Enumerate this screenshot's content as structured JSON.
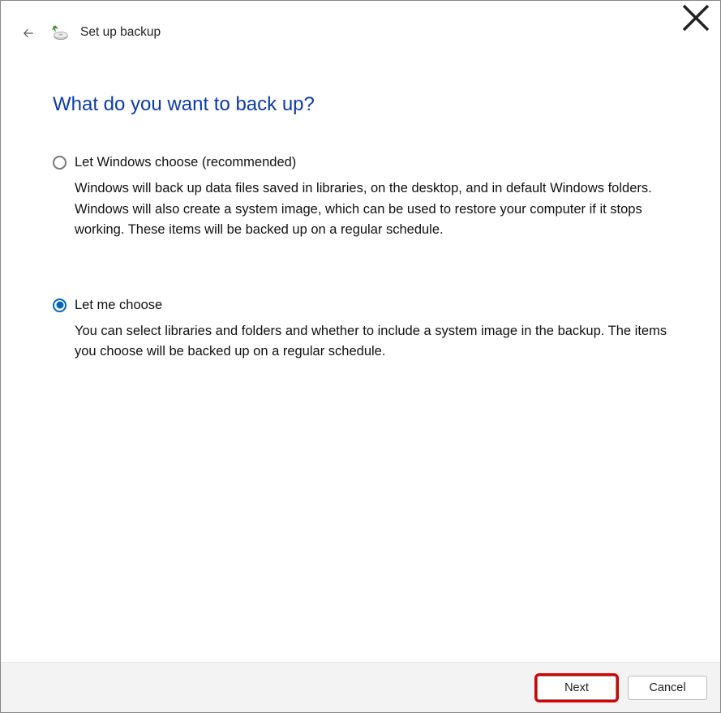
{
  "window": {
    "title": "Set up backup"
  },
  "heading": "What do you want to back up?",
  "options": {
    "option1": {
      "label": "Let Windows choose (recommended)",
      "description": "Windows will back up data files saved in libraries, on the desktop, and in default Windows folders. Windows will also create a system image, which can be used to restore your computer if it stops working. These items will be backed up on a regular schedule.",
      "selected": false
    },
    "option2": {
      "label": "Let me choose",
      "description": "You can select libraries and folders and whether to include a system image in the backup. The items you choose will be backed up on a regular schedule.",
      "selected": true
    }
  },
  "footer": {
    "next": "Next",
    "cancel": "Cancel"
  }
}
